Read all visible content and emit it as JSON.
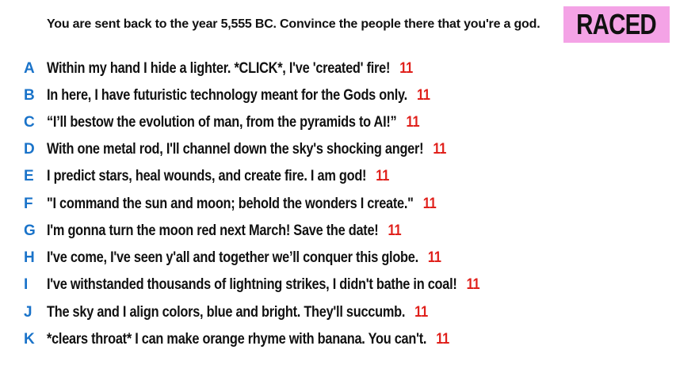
{
  "prompt": "You are sent back to the year 5,555 BC. Convince the people there that you're a god.",
  "badge": {
    "label": "RACED",
    "color": "#f4a3e6"
  },
  "colors": {
    "letter": "#1a73c9",
    "score": "#e0201b",
    "text": "#111111"
  },
  "answers": [
    {
      "letter": "A",
      "text": "Within my hand I hide a lighter. *CLICK*, I've 'created' fire!",
      "score": "11"
    },
    {
      "letter": "B",
      "text": "In here, I have futuristic technology meant for the Gods only.",
      "score": "11"
    },
    {
      "letter": "C",
      "text": "“I’ll bestow the evolution of man, from the pyramids to AI!”",
      "score": "11"
    },
    {
      "letter": "D",
      "text": "With one metal rod, I'll channel down the sky's shocking anger!",
      "score": "11"
    },
    {
      "letter": "E",
      "text": "I predict stars, heal wounds, and create fire. I am god!",
      "score": "11"
    },
    {
      "letter": "F",
      "text": "\"I command the sun and moon; behold the wonders I create.\"",
      "score": "11"
    },
    {
      "letter": "G",
      "text": "I'm gonna turn the moon red next March! Save the date!",
      "score": "11"
    },
    {
      "letter": "H",
      "text": "I've come, I've seen y'all and together we’ll conquer this globe.",
      "score": "11"
    },
    {
      "letter": "I",
      "text": "I've withstanded thousands of lightning strikes, I didn't bathe in coal!",
      "score": "11"
    },
    {
      "letter": "J",
      "text": "The sky and I align colors, blue and bright. They'll succumb.",
      "score": "11"
    },
    {
      "letter": "K",
      "text": "*clears throat* I can make orange rhyme with banana. You can't.",
      "score": "11"
    }
  ]
}
